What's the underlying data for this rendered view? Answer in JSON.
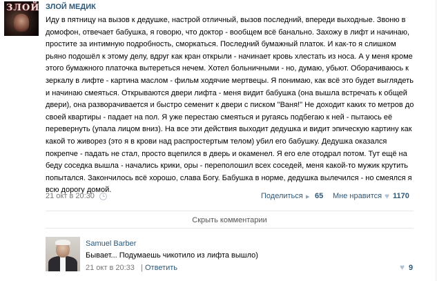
{
  "post": {
    "author": "ЗЛОЙ МЕДИК",
    "avatar_text": "ЗЛОЙ",
    "text": "Иду в пятницу на вызов к дедушке, настрой отличный, вызов последний, впереди выходные. Звоню в домофон, отвечает бабушка, я говорю, что доктор - вообщем всё банально. Захожу в лифт и начинаю, простите за интимную подробность, сморкаться. Последний бумажный платок. И как-то я слишком рьяно подошёл к этому делу, вдруг как кран открыли - начинает кровь хлестать из носа. А у меня кроме этого бумажного платочка вытереться нечем. Хотел больничными - но, думаю, убьют. Оборачиваюсь к зеркалу в лифте - картина маслом - фильм ходячие мертвецы. Я понимаю, как всё это будет выглядеть и начинаю смеяться. Открываются двери лифта - меня видит бабушка (она вышла встречать к общей двери), она разворачивается и быстро семенит к двери с писком \"Ваня!\" Не доходит каких то метров до своей квартиры - падает на пол. Я уже перестаю смеяться и ругаясь подбегаю к ней - пытаюсь её перевернуть (упала лицом вниз). На все эти действия выходит дедушка и видит эпическую картину как какой то живорез (это я в крови над распростертым телом) убил его бабушку. Дедушка оказался покрепче - падать не стал, просто вцепился в дверь и окаменел. Я его еле отодрал потом. Тут ещё на беду соседка вышла - начались крики, оры - переполошил всех соседей, меня какой-то мужик крутить попытался. Закончилось всё хорошо, слава Богу. Бабушка в норме, дедушка вылечился - но смеялся я всю дорогу домой.",
    "time": "21 окт в 20:30",
    "share_label": "Поделиться",
    "share_count": "65",
    "like_label": "Мне нравится",
    "like_count": "1170"
  },
  "hide_comments_label": "Скрыть комментарии",
  "comment": {
    "author": "Samuel Barber",
    "text": "Бывает... Подумаешь чикотило из лифта вышло)",
    "time": "21 окт в 20:33",
    "separator": "|",
    "reply_label": "Ответить",
    "like_count": "9"
  },
  "icons": {
    "share": "megaphone-icon",
    "like": "heart-icon",
    "time": "clock-icon"
  },
  "colors": {
    "link": "#2b587a",
    "muted": "#777777",
    "icon": "#b3c2d3"
  }
}
